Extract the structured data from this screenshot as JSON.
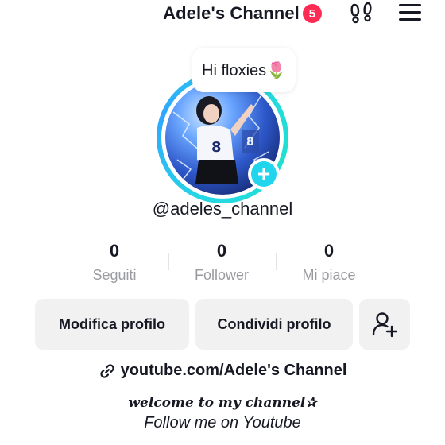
{
  "header": {
    "title": "Adele's Channel",
    "notification_count": "5",
    "footprint_icon": "footprints-icon",
    "menu_icon": "hamburger-menu-icon"
  },
  "profile": {
    "note": "Hi floxies🌷",
    "username": "@adeles_channel",
    "add_icon": "plus-icon"
  },
  "stats": [
    {
      "value": "0",
      "label": "Seguiti"
    },
    {
      "value": "0",
      "label": "Follower"
    },
    {
      "value": "0",
      "label": "Mi piace"
    }
  ],
  "actions": {
    "edit_profile": "Modifica profilo",
    "share_profile": "Condividi profilo",
    "add_friend_icon": "add-user-icon"
  },
  "bio": {
    "link": "youtube.com/Adele's Channel",
    "line1": "welcome to my channel✰",
    "line2": "Follow me on Youtube"
  },
  "colors": {
    "badge_red": "#fe2c55",
    "ring_cyan": "#25d7e4",
    "add_badge": "#20d5ec",
    "button_bg": "#f1f1f2",
    "muted_text": "#9a9ba0"
  }
}
